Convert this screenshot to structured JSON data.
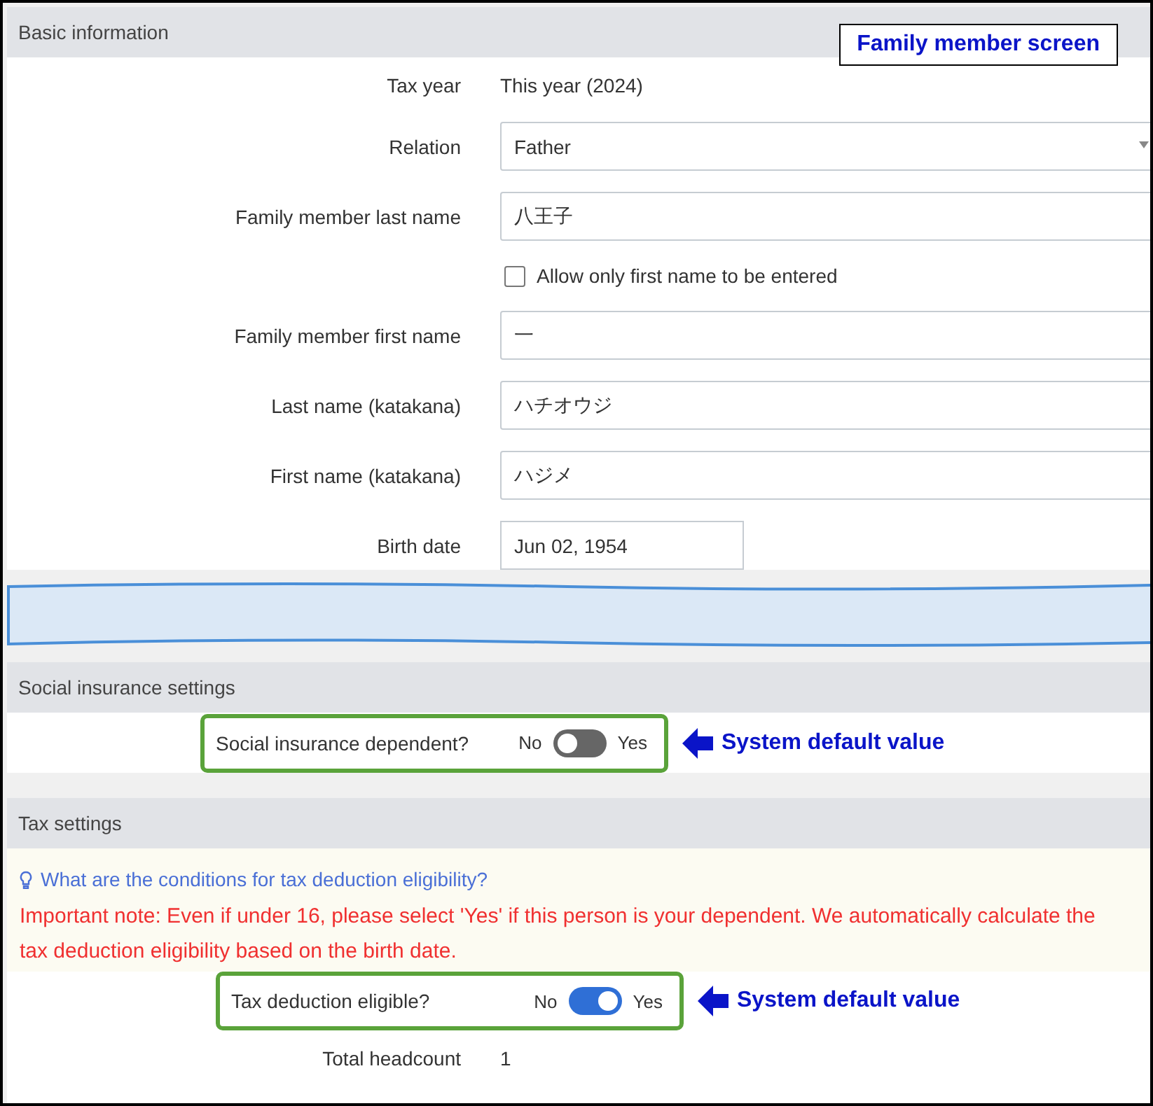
{
  "callout": {
    "title": "Family member screen"
  },
  "basic_section": {
    "title": "Basic information",
    "fields": [
      {
        "kind": "text",
        "label": "Tax year",
        "value": "This year (2024)"
      },
      {
        "kind": "select",
        "label": "Relation",
        "value": "Father"
      },
      {
        "kind": "input",
        "label": "Family member last name",
        "value": "八王子"
      },
      {
        "kind": "checkbox",
        "text": "Allow only first name to be entered",
        "checked": false
      },
      {
        "kind": "input",
        "label": "Family member first name",
        "value": "一"
      },
      {
        "kind": "input",
        "label": "Last name (katakana)",
        "value": "ハチオウジ"
      },
      {
        "kind": "input",
        "label": "First name (katakana)",
        "value": "ハジメ"
      },
      {
        "kind": "date",
        "label": "Birth date",
        "value": "Jun 02, 1954"
      }
    ]
  },
  "social_section": {
    "title": "Social insurance settings",
    "toggle": {
      "label": "Social insurance dependent?",
      "off_label": "No",
      "on_label": "Yes",
      "on": false
    },
    "annotation": "System default value"
  },
  "tax_section": {
    "title": "Tax settings",
    "help_link": "What are the conditions for tax deduction eligibility?",
    "note": "Important note: Even if under 16, please select 'Yes' if this person is your dependent. We automatically calculate the tax deduction eligibility based on the birth date.",
    "toggle": {
      "label": "Tax deduction eligible?",
      "off_label": "No",
      "on_label": "Yes",
      "on": true
    },
    "annotation": "System default value",
    "summary": {
      "label": "Total headcount",
      "value": "1"
    }
  }
}
